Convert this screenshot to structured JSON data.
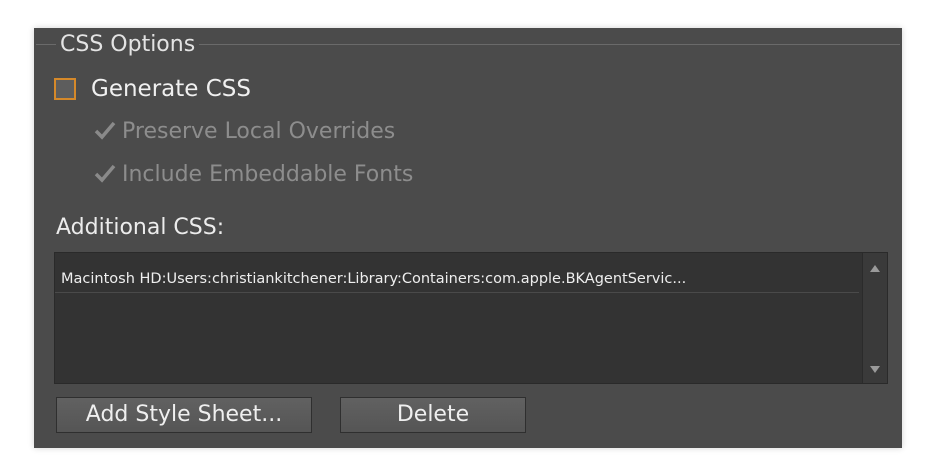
{
  "group": {
    "title": "CSS Options"
  },
  "generate_css": {
    "label": "Generate CSS",
    "checked": false
  },
  "sub_options": [
    {
      "label": "Preserve Local Overrides",
      "checked": true,
      "enabled": false
    },
    {
      "label": "Include Embeddable Fonts",
      "checked": true,
      "enabled": false
    }
  ],
  "additional_css": {
    "label": "Additional CSS:",
    "items": [
      "Macintosh HD:Users:christiankitchener:Library:Containers:com.apple.BKAgentServic..."
    ]
  },
  "buttons": {
    "add_style_sheet": "Add Style Sheet...",
    "delete": "Delete"
  },
  "colors": {
    "panel_bg": "#4b4b4b",
    "checkbox_border_accent": "#d5892a",
    "list_bg": "#333333"
  },
  "icons": {
    "checkmark": "checkmark-icon",
    "scroll_up": "scroll-up-arrow-icon",
    "scroll_down": "scroll-down-arrow-icon"
  }
}
